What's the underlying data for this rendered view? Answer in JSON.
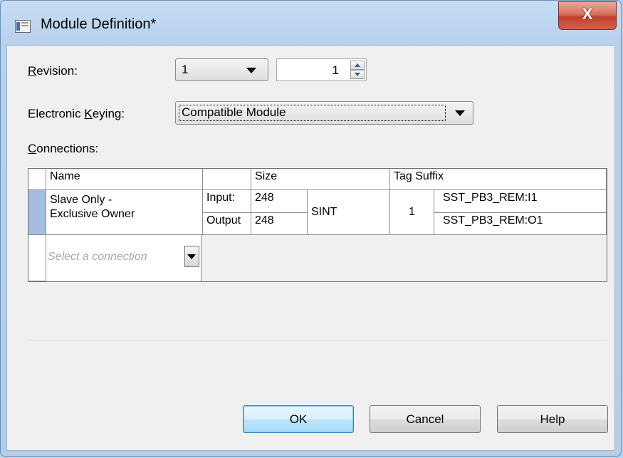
{
  "window": {
    "title": "Module Definition*",
    "close_label": "X"
  },
  "revision": {
    "label_prefix": "",
    "label_accel": "R",
    "label_rest": "evision:",
    "major_value": "1",
    "minor_value": "1"
  },
  "keying": {
    "label_prefix": "Electronic ",
    "label_accel": "K",
    "label_rest": "eying:",
    "value": "Compatible Module"
  },
  "connections": {
    "label_accel": "C",
    "label_rest": "onnections:",
    "headers": {
      "name": "Name",
      "size": "Size",
      "tag_suffix": "Tag Suffix"
    },
    "row": {
      "name_line1": "Slave Only -",
      "name_line2": "Exclusive Owner",
      "input_label": "Input:",
      "input_size": "248",
      "output_label": "Output",
      "output_size": "248",
      "type": "SINT",
      "count": "1",
      "input_tag": "SST_PB3_REM:I1",
      "output_tag": "SST_PB3_REM:O1"
    },
    "new_row_placeholder": "Select a connection"
  },
  "buttons": {
    "ok": "OK",
    "cancel": "Cancel",
    "help": "Help"
  },
  "colors": {
    "selected_row_header": "#a6bde0",
    "default_button_border": "#3c7fb1"
  },
  "icons": {
    "window_icon": "window-icon",
    "close": "close-icon",
    "dropdown": "chevron-down-icon",
    "spin_up": "spin-up-icon",
    "spin_down": "spin-down-icon"
  }
}
